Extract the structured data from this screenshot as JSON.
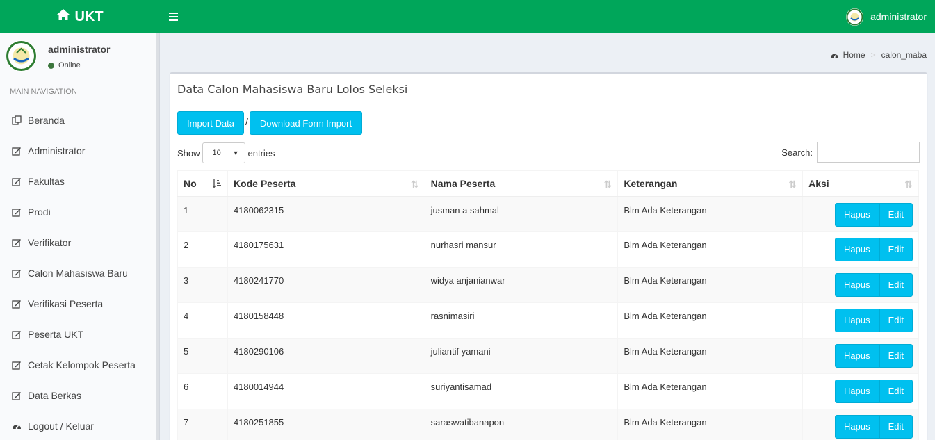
{
  "header": {
    "app_title": "UKT",
    "username": "administrator"
  },
  "sidebar": {
    "username": "administrator",
    "status": "Online",
    "nav_header": "MAIN NAVIGATION",
    "items": [
      {
        "label": "Beranda",
        "icon": "copy-icon"
      },
      {
        "label": "Administrator",
        "icon": "edit-icon"
      },
      {
        "label": "Fakultas",
        "icon": "edit-icon"
      },
      {
        "label": "Prodi",
        "icon": "edit-icon"
      },
      {
        "label": "Verifikator",
        "icon": "edit-icon"
      },
      {
        "label": "Calon Mahasiswa Baru",
        "icon": "edit-icon"
      },
      {
        "label": "Verifikasi Peserta",
        "icon": "edit-icon"
      },
      {
        "label": "Peserta UKT",
        "icon": "edit-icon"
      },
      {
        "label": "Cetak Kelompok Peserta",
        "icon": "edit-icon"
      },
      {
        "label": "Data Berkas",
        "icon": "edit-icon"
      },
      {
        "label": "Logout / Keluar",
        "icon": "dashboard-icon"
      }
    ]
  },
  "breadcrumb": {
    "home": "Home",
    "current": "calon_maba"
  },
  "main": {
    "title": "Data Calon Mahasiswa Baru Lolos Seleksi",
    "import_label": "Import Data",
    "separator": "/",
    "download_label": "Download Form Import",
    "show_label": "Show",
    "entries_value": "10",
    "entries_label": "entries",
    "search_label": "Search:",
    "search_value": ""
  },
  "table": {
    "columns": [
      "No",
      "Kode Peserta",
      "Nama Peserta",
      "Keterangan",
      "Aksi"
    ],
    "rows": [
      {
        "no": "1",
        "kode": "4180062315",
        "nama": "jusman a sahmal",
        "ket": "Blm Ada Keterangan"
      },
      {
        "no": "2",
        "kode": "4180175631",
        "nama": "nurhasri mansur",
        "ket": "Blm Ada Keterangan"
      },
      {
        "no": "3",
        "kode": "4180241770",
        "nama": "widya anjanianwar",
        "ket": "Blm Ada Keterangan"
      },
      {
        "no": "4",
        "kode": "4180158448",
        "nama": "rasnimasiri",
        "ket": "Blm Ada Keterangan"
      },
      {
        "no": "5",
        "kode": "4180290106",
        "nama": "juliantif yamani",
        "ket": "Blm Ada Keterangan"
      },
      {
        "no": "6",
        "kode": "4180014944",
        "nama": "suriyantisamad",
        "ket": "Blm Ada Keterangan"
      },
      {
        "no": "7",
        "kode": "4180251855",
        "nama": "saraswatibanapon",
        "ket": "Blm Ada Keterangan"
      }
    ],
    "hapus_label": "Hapus",
    "edit_label": "Edit"
  },
  "colors": {
    "header": "#00a65a",
    "button": "#00c0ef",
    "status_online": "#3c763d"
  }
}
